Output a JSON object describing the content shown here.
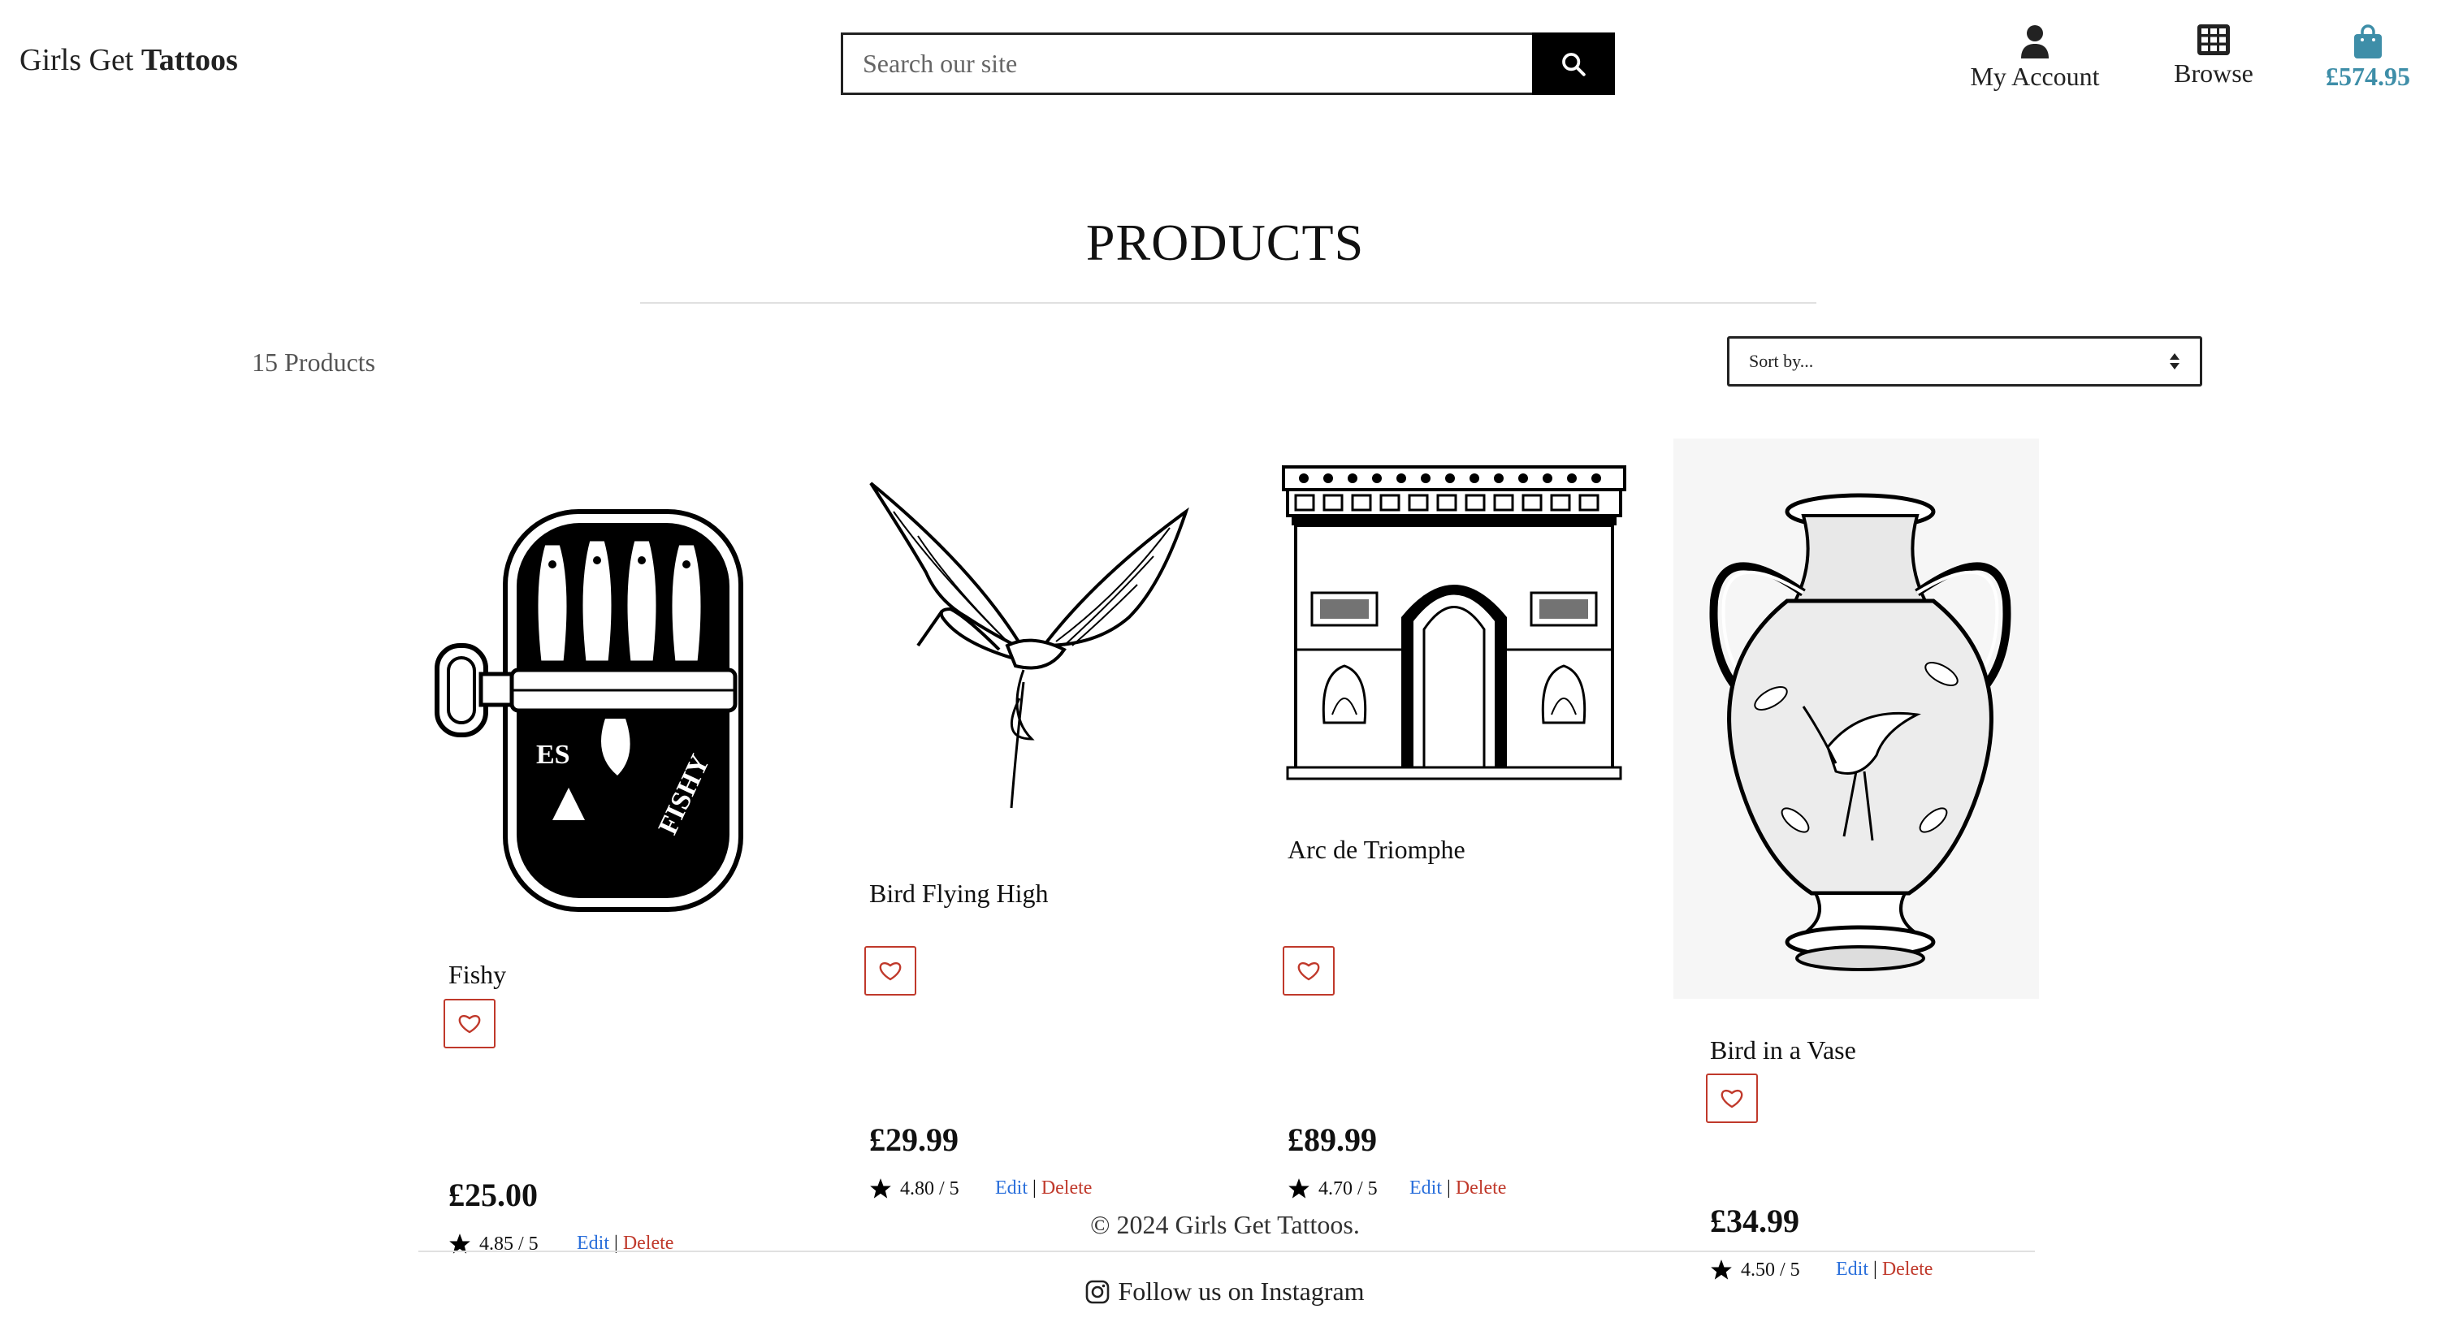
{
  "header": {
    "brand_prefix": "Girls Get",
    "brand_strong": "Tattoos",
    "search_placeholder": "Search our site",
    "nav": {
      "account": "My Account",
      "browse": "Browse",
      "bag_total": "£574.95"
    }
  },
  "main": {
    "title": "PRODUCTS",
    "count": "15 Products",
    "sort_label": "Sort by...",
    "products": [
      {
        "name": "Fishy",
        "price": "£25.00",
        "rating": "4.85 / 5",
        "edit": "Edit",
        "delete": "Delete"
      },
      {
        "name": "Bird Flying High",
        "price": "£29.99",
        "rating": "4.80 / 5",
        "edit": "Edit",
        "delete": "Delete"
      },
      {
        "name": "Arc de Triomphe",
        "price": "£89.99",
        "rating": "4.70 / 5",
        "edit": "Edit",
        "delete": "Delete"
      },
      {
        "name": "Bird in a Vase",
        "price": "£34.99",
        "rating": "4.50 / 5",
        "edit": "Edit",
        "delete": "Delete"
      }
    ]
  },
  "footer": {
    "copyright": "© 2024 Girls Get Tattoos.",
    "instagram": "Follow us on Instagram"
  },
  "colors": {
    "accent": "#3e8ea8",
    "edit": "#2a6fdb",
    "delete": "#c0392b",
    "wishlist_border": "#c0392b"
  }
}
